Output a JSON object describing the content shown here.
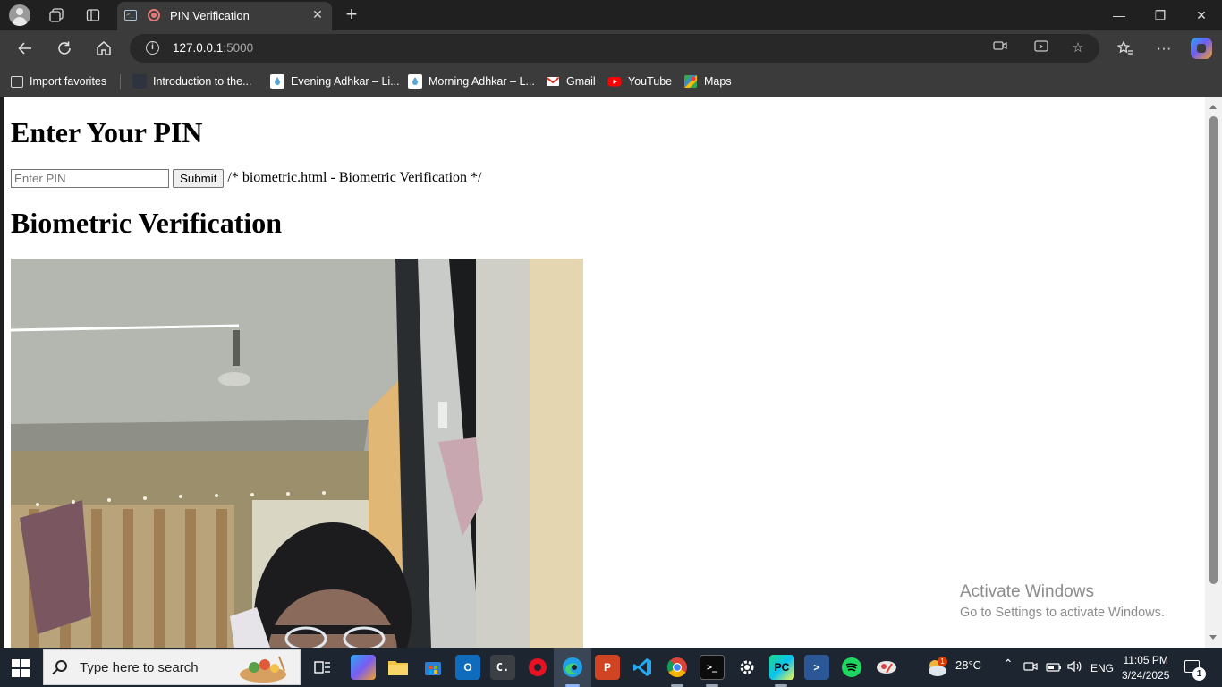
{
  "tab": {
    "title": "PIN Verification"
  },
  "address": {
    "host": "127.0.0.1",
    "port": ":5000"
  },
  "favorites": [
    {
      "label": "Import favorites",
      "icon": "import-icon"
    },
    {
      "label": "Introduction to the...",
      "icon": "page-icon"
    },
    {
      "label": "Evening Adhkar – Li...",
      "icon": "drop-icon"
    },
    {
      "label": "Morning Adhkar – L...",
      "icon": "drop-icon"
    },
    {
      "label": "Gmail",
      "icon": "gmail-icon"
    },
    {
      "label": "YouTube",
      "icon": "youtube-icon"
    },
    {
      "label": "Maps",
      "icon": "maps-icon"
    }
  ],
  "page": {
    "heading": "Enter Your PIN",
    "pin_placeholder": "Enter PIN",
    "submit_label": "Submit",
    "comment_text": "/* biometric.html - Biometric Verification */",
    "biometric_heading": "Biometric Verification"
  },
  "watermark": {
    "line1": "Activate Windows",
    "line2": "Go to Settings to activate Windows."
  },
  "taskbar": {
    "search_placeholder": "Type here to search",
    "weather": "28°C",
    "language": "ENG",
    "time": "11:05 PM",
    "date": "3/24/2025",
    "notification_count": "1",
    "weather_badge": "1"
  },
  "colors": {
    "chrome_dark": "#202020",
    "toolbar": "#3b3b3b",
    "taskbar": "#1d2530",
    "accent": "#8ab4f8"
  }
}
